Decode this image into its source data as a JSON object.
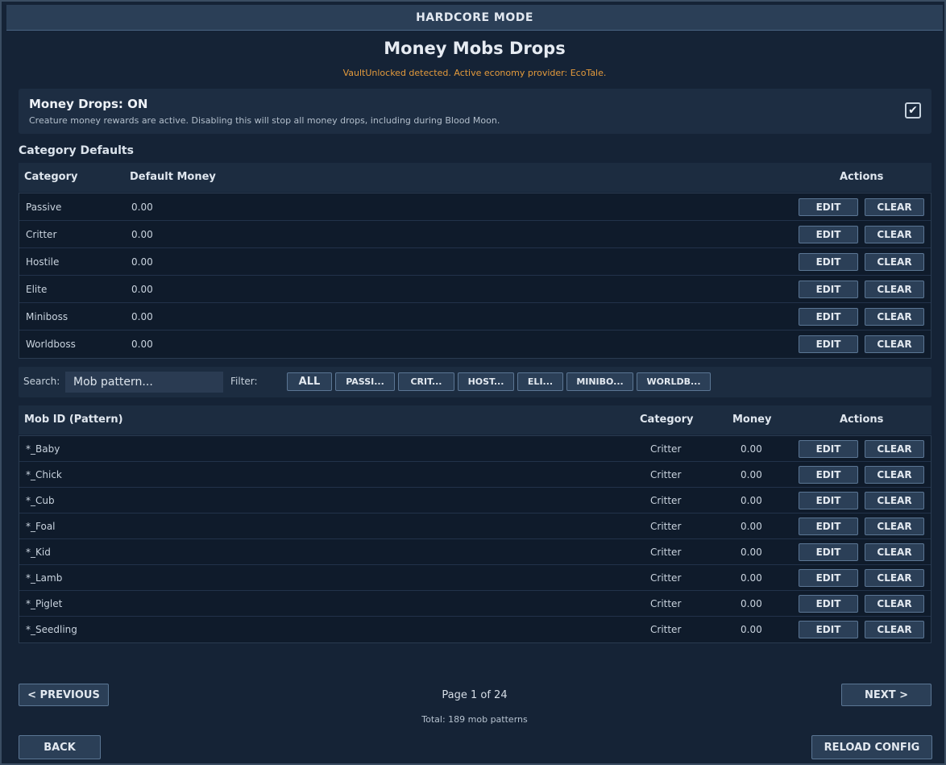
{
  "window": {
    "title": "HARDCORE MODE"
  },
  "page": {
    "title": "Money Mobs Drops",
    "notice": "VaultUnlocked detected. Active economy provider: EcoTale."
  },
  "toggle": {
    "title": "Money Drops: ON",
    "description": "Creature money rewards are active. Disabling this will stop all money drops, including during Blood Moon.",
    "checked": true,
    "check_glyph": "✔"
  },
  "category_defaults": {
    "section_title": "Category Defaults",
    "headers": {
      "category": "Category",
      "default_money": "Default Money",
      "actions": "Actions"
    },
    "rows": [
      {
        "category": "Passive",
        "money": "0.00"
      },
      {
        "category": "Critter",
        "money": "0.00"
      },
      {
        "category": "Hostile",
        "money": "0.00"
      },
      {
        "category": "Elite",
        "money": "0.00"
      },
      {
        "category": "Miniboss",
        "money": "0.00"
      },
      {
        "category": "Worldboss",
        "money": "0.00"
      }
    ]
  },
  "actions": {
    "edit": "EDIT",
    "clear": "CLEAR"
  },
  "search": {
    "label": "Search:",
    "placeholder": "Mob pattern...",
    "filter_label": "Filter:",
    "filters": [
      "ALL",
      "PASSI...",
      "CRIT...",
      "HOST...",
      "ELI...",
      "MINIBO...",
      "WORLDB..."
    ]
  },
  "mobs": {
    "headers": {
      "mob_id": "Mob ID (Pattern)",
      "category": "Category",
      "money": "Money",
      "actions": "Actions"
    },
    "rows": [
      {
        "id": "*_Baby",
        "category": "Critter",
        "money": "0.00"
      },
      {
        "id": "*_Chick",
        "category": "Critter",
        "money": "0.00"
      },
      {
        "id": "*_Cub",
        "category": "Critter",
        "money": "0.00"
      },
      {
        "id": "*_Foal",
        "category": "Critter",
        "money": "0.00"
      },
      {
        "id": "*_Kid",
        "category": "Critter",
        "money": "0.00"
      },
      {
        "id": "*_Lamb",
        "category": "Critter",
        "money": "0.00"
      },
      {
        "id": "*_Piglet",
        "category": "Critter",
        "money": "0.00"
      },
      {
        "id": "*_Seedling",
        "category": "Critter",
        "money": "0.00"
      }
    ]
  },
  "pagination": {
    "previous": "< PREVIOUS",
    "next": "NEXT >",
    "page_info": "Page 1 of 24",
    "total": "Total: 189 mob patterns"
  },
  "footer": {
    "back": "BACK",
    "reload": "RELOAD CONFIG"
  },
  "colors": {
    "accent_notice": "#e39a3c",
    "button_bg": "#2b3f57",
    "panel_bg": "#1c2c40"
  }
}
